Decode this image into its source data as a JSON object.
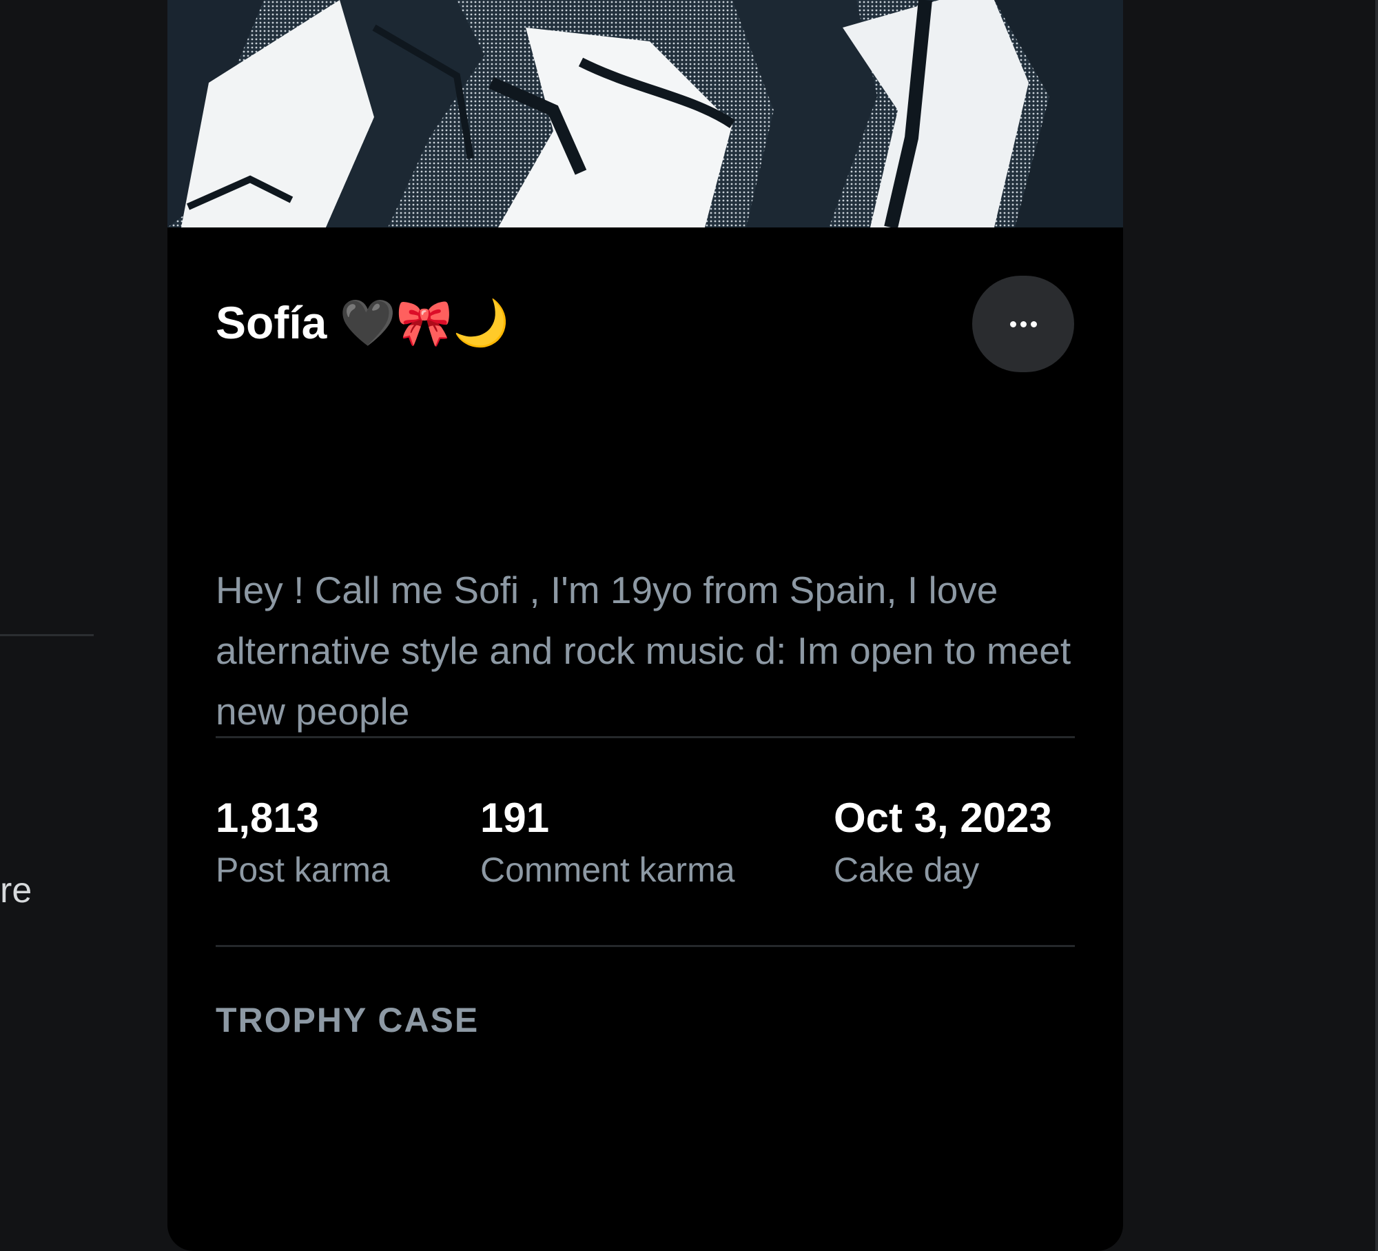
{
  "left_panel": {
    "text_fragment": "re"
  },
  "profile": {
    "display_name": "Sofía 🖤🎀🌙",
    "more_button_icon": "ellipsis-icon",
    "bio": "Hey ! Call me Sofi , I'm 19yo from Spain, I love alternative style and rock music d: Im open to meet new people"
  },
  "stats": {
    "post_karma": {
      "value": "1,813",
      "label": "Post karma"
    },
    "comment_karma": {
      "value": "191",
      "label": "Comment karma"
    },
    "cake_day": {
      "value": "Oct 3, 2023",
      "label": "Cake day"
    }
  },
  "trophy_case": {
    "heading": "TROPHY CASE"
  },
  "colors": {
    "page_background": "#121315",
    "card_background": "#000000",
    "muted_text": "#8d99a4",
    "button_background": "#2a2c2f"
  }
}
